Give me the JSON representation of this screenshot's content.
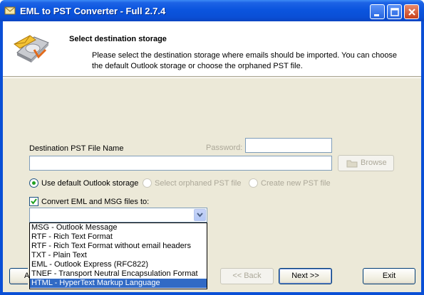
{
  "window": {
    "title": "EML to PST Converter - Full 2.7.4",
    "colors": {
      "titlebar": "#0a55de",
      "selection": "#316ac5",
      "face": "#ece9d8"
    }
  },
  "header": {
    "title": "Select destination storage",
    "description": "Please select the destination storage where emails should be imported. You can choose the default Outlook storage or choose the orphaned PST file."
  },
  "form": {
    "pst_label": "Destination PST File Name",
    "pst_value": "",
    "password_label": "Password:",
    "password_value": "",
    "browse_label": "Browse",
    "radio_default": "Use default Outlook storage",
    "radio_orphaned": "Select orphaned PST file",
    "radio_create": "Create new PST file",
    "convert_label": "Convert EML and MSG files to:",
    "convert_checked": true,
    "combo_value": "",
    "options": [
      "MSG - Outlook Message",
      "RTF - Rich Text Format",
      "RTF - Rich Text Format without email headers",
      "TXT - Plain Text",
      "EML - Outlook Express (RFC822)",
      "TNEF - Transport Neutral Encapsulation Format",
      "HTML - HyperText Markup Language"
    ],
    "selected_option": "HTML - HyperText Markup Language"
  },
  "footer": {
    "back_label": "<< Back",
    "next_label": "Next >>",
    "exit_label": "Exit",
    "about_label": "A"
  },
  "icons": [
    "app-icon",
    "minimize-icon",
    "maximize-icon",
    "close-icon",
    "disk-email-icon",
    "folder-icon",
    "chevron-down-icon"
  ]
}
